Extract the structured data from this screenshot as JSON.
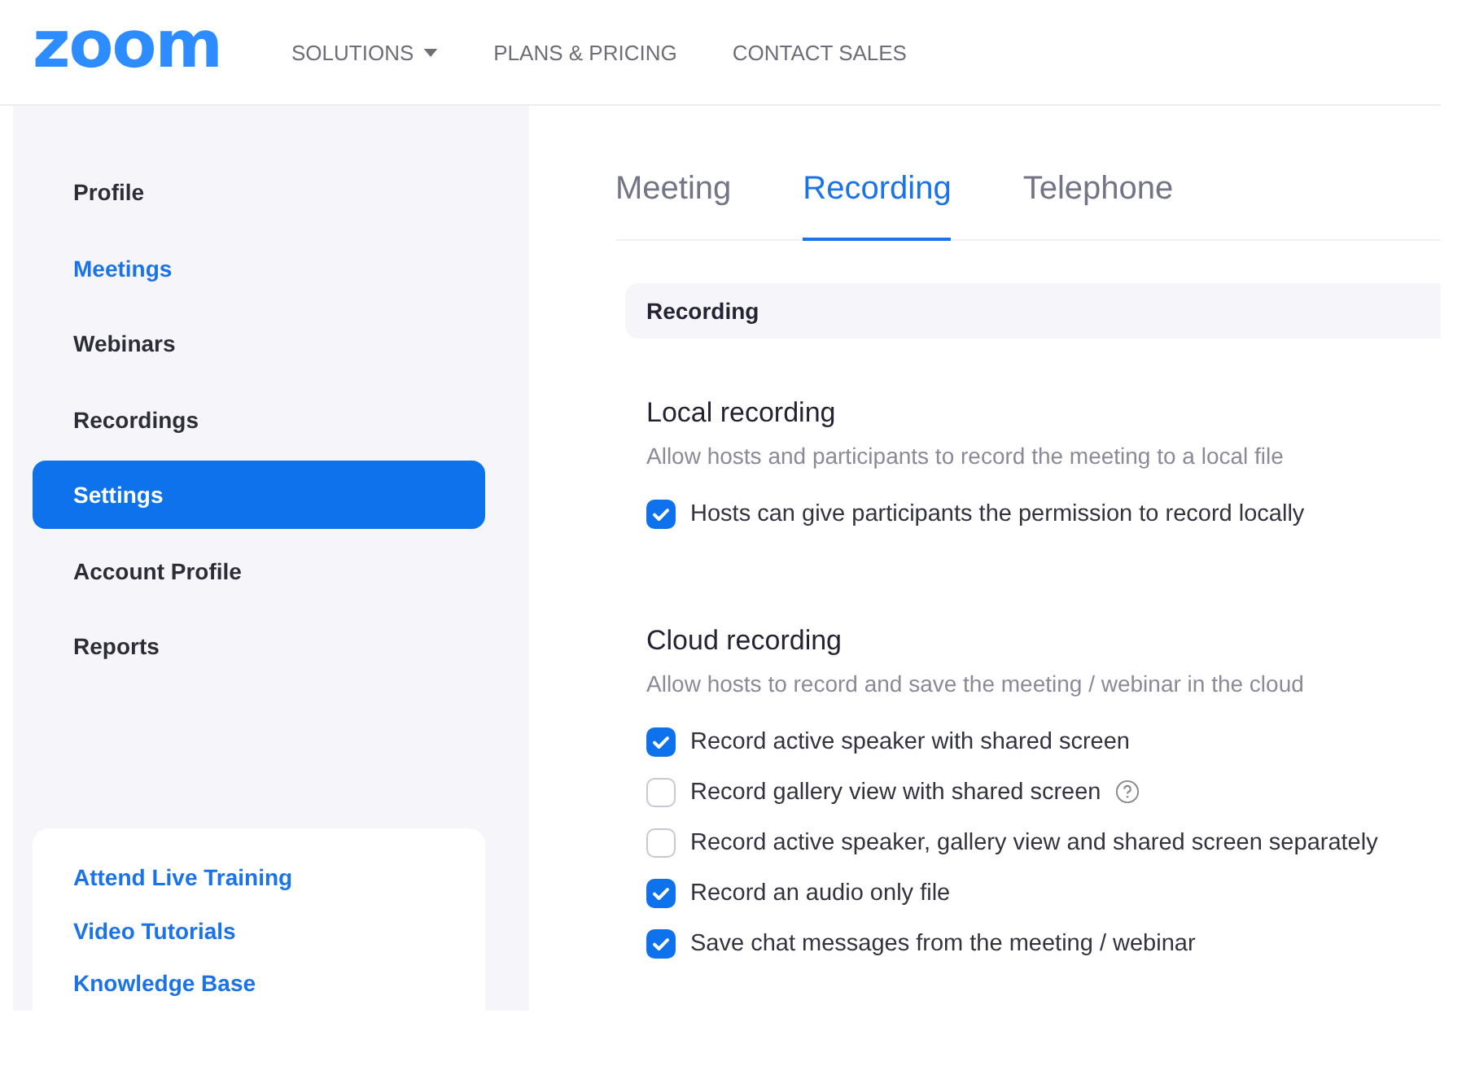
{
  "header": {
    "logo": "zoom",
    "nav": [
      {
        "label": "SOLUTIONS",
        "dropdown": true
      },
      {
        "label": "PLANS & PRICING",
        "dropdown": false
      },
      {
        "label": "CONTACT SALES",
        "dropdown": false
      }
    ]
  },
  "sidebar": {
    "items": [
      {
        "label": "Profile",
        "selected": false,
        "highlighted": false
      },
      {
        "label": "Meetings",
        "selected": false,
        "highlighted": true
      },
      {
        "label": "Webinars",
        "selected": false,
        "highlighted": false
      },
      {
        "label": "Recordings",
        "selected": false,
        "highlighted": false
      },
      {
        "label": "Settings",
        "selected": true,
        "highlighted": false
      },
      {
        "label": "Account Profile",
        "selected": false,
        "highlighted": false
      },
      {
        "label": "Reports",
        "selected": false,
        "highlighted": false
      }
    ],
    "help_links": [
      "Attend Live Training",
      "Video Tutorials",
      "Knowledge Base"
    ]
  },
  "tabs": [
    {
      "label": "Meeting",
      "selected": false
    },
    {
      "label": "Recording",
      "selected": true
    },
    {
      "label": "Telephone",
      "selected": false
    }
  ],
  "section_header": "Recording",
  "groups": [
    {
      "title": "Local recording",
      "description": "Allow hosts and participants to record the meeting to a local file",
      "options": [
        {
          "label": "Hosts can give participants the permission to record locally",
          "checked": true,
          "help": false
        }
      ]
    },
    {
      "title": "Cloud recording",
      "description": "Allow hosts to record and save the meeting / webinar in the cloud",
      "options": [
        {
          "label": "Record active speaker with shared screen",
          "checked": true,
          "help": false
        },
        {
          "label": "Record gallery view with shared screen",
          "checked": false,
          "help": true
        },
        {
          "label": "Record active speaker, gallery view and shared screen separately",
          "checked": false,
          "help": false
        },
        {
          "label": "Record an audio only file",
          "checked": true,
          "help": false
        },
        {
          "label": "Save chat messages from the meeting / webinar",
          "checked": true,
          "help": false
        }
      ]
    }
  ]
}
